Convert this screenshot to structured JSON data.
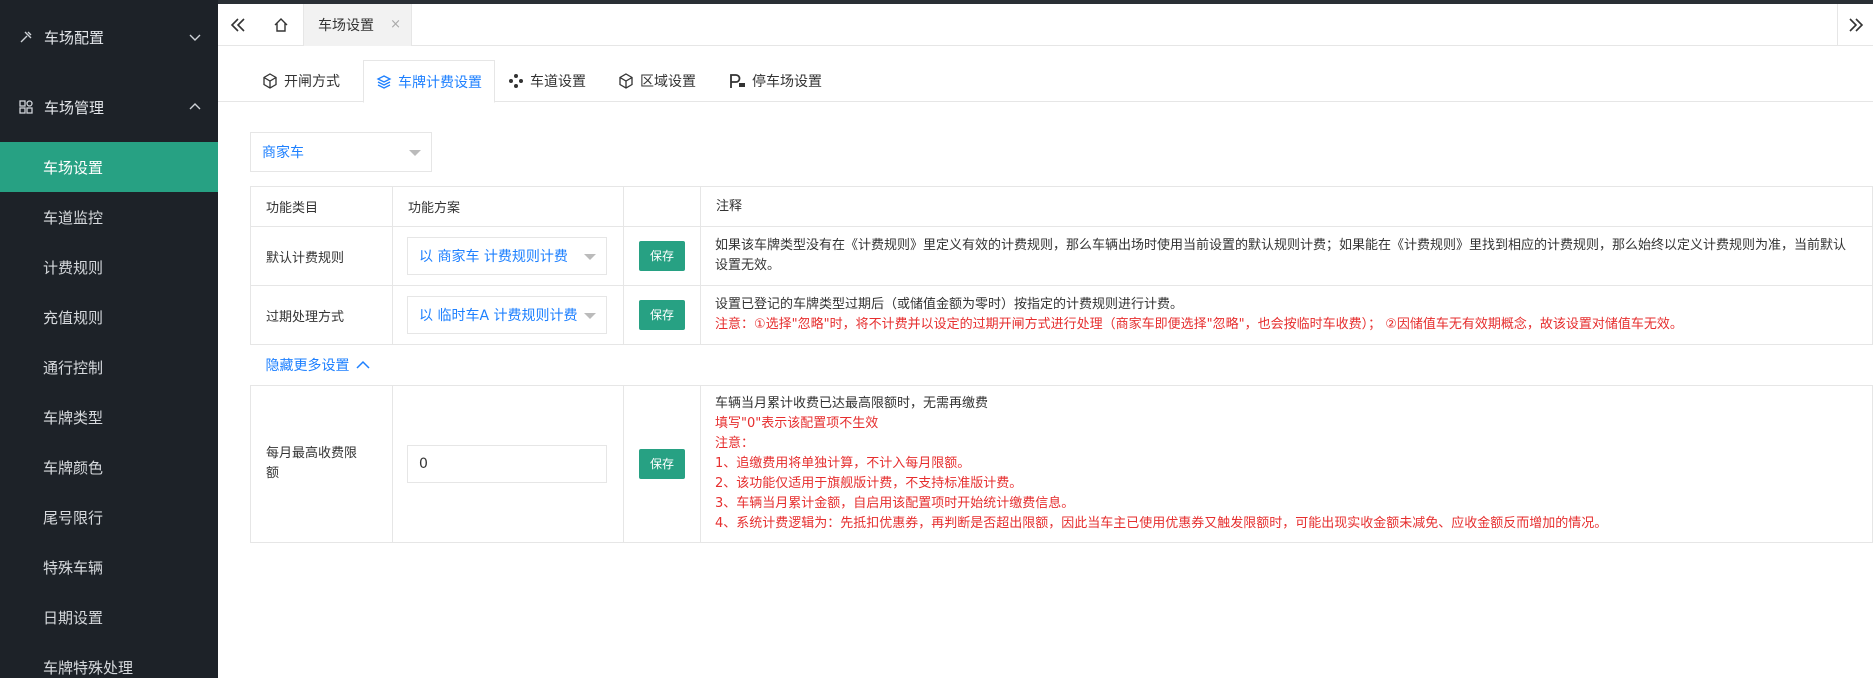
{
  "sidebar": {
    "groups": [
      {
        "label": "车场配置"
      },
      {
        "label": "车场管理"
      }
    ],
    "items": [
      {
        "label": "车场设置"
      },
      {
        "label": "车道监控"
      },
      {
        "label": "计费规则"
      },
      {
        "label": "充值规则"
      },
      {
        "label": "通行控制"
      },
      {
        "label": "车牌类型"
      },
      {
        "label": "车牌颜色"
      },
      {
        "label": "尾号限行"
      },
      {
        "label": "特殊车辆"
      },
      {
        "label": "日期设置"
      },
      {
        "label": "车牌特殊处理"
      }
    ]
  },
  "topbar": {
    "page_tab": "车场设置",
    "close_glyph": "×"
  },
  "subtabs": [
    {
      "label": "开闸方式"
    },
    {
      "label": "车牌计费设置"
    },
    {
      "label": "车道设置"
    },
    {
      "label": "区域设置"
    },
    {
      "label": "停车场设置"
    }
  ],
  "plate_select": {
    "value": "商家车"
  },
  "table": {
    "headers": [
      "功能类目",
      "功能方案",
      "",
      "注释"
    ],
    "save_label": "保存",
    "rows": {
      "default_rule": {
        "category": "默认计费规则",
        "plan": "以 商家车 计费规则计费",
        "note": "如果该车牌类型没有在《计费规则》里定义有效的计费规则，那么车辆出场时使用当前设置的默认规则计费；如果能在《计费规则》里找到相应的计费规则，那么始终以定义计费规则为准，当前默认设置无效。"
      },
      "expired": {
        "category": "过期处理方式",
        "plan": "以 临时车A 计费规则计费",
        "note": "设置已登记的车牌类型过期后（或储值金额为零时）按指定的计费规则进行计费。",
        "note_red": "注意：①选择\"忽略\"时，将不计费并以设定的过期开闸方式进行处理（商家车即便选择\"忽略\"，也会按临时车收费）；  ②因储值车无有效期概念，故该设置对储值车无效。"
      },
      "toggle": {
        "label": "隐藏更多设置"
      },
      "monthly_cap": {
        "category": "每月最高收费限额",
        "value": "0",
        "note": "车辆当月累计收费已达最高限额时，无需再缴费",
        "note_red_lines": [
          "填写\"0\"表示该配置项不生效",
          "注意：",
          "1、追缴费用将单独计算，不计入每月限额。",
          "2、该功能仅适用于旗舰版计费，不支持标准版计费。",
          "3、车辆当月累计金额，自启用该配置项时开始统计缴费信息。",
          "4、系统计费逻辑为：先抵扣优惠券，再判断是否超出限额，因此当车主已使用优惠券又触发限额时，可能出现实收金额未减免、应收金额反而增加的情况。"
        ]
      }
    }
  },
  "colors": {
    "sidebar_bg": "#1d2228",
    "active_green": "#27a183",
    "link_blue": "#1e80ff",
    "warning_red": "#e62e2e"
  }
}
